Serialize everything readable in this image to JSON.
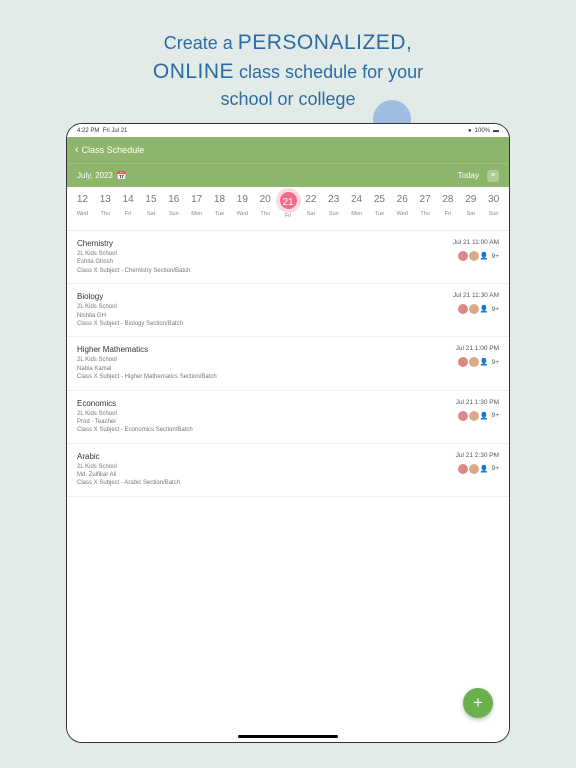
{
  "promo": {
    "line1_a": "Create a ",
    "line1_b": "PERSONALIZED,",
    "line2_a": "ONLINE",
    "line2_b": " class schedule for your",
    "line3": "school or college"
  },
  "status": {
    "time": "4:22 PM",
    "date": "Fri Jul 21",
    "battery": "100%"
  },
  "nav": {
    "back": "Class Schedule"
  },
  "toolbar": {
    "month": "July, 2023",
    "today": "Today"
  },
  "days": [
    {
      "n": "12",
      "d": "Wed"
    },
    {
      "n": "13",
      "d": "Thu"
    },
    {
      "n": "14",
      "d": "Fri"
    },
    {
      "n": "15",
      "d": "Sat"
    },
    {
      "n": "16",
      "d": "Sun"
    },
    {
      "n": "17",
      "d": "Mon"
    },
    {
      "n": "18",
      "d": "Tue"
    },
    {
      "n": "19",
      "d": "Wed"
    },
    {
      "n": "20",
      "d": "Thu"
    },
    {
      "n": "21",
      "d": "Fri",
      "sel": true
    },
    {
      "n": "22",
      "d": "Sat"
    },
    {
      "n": "23",
      "d": "Sun"
    },
    {
      "n": "24",
      "d": "Mon"
    },
    {
      "n": "25",
      "d": "Tue"
    },
    {
      "n": "26",
      "d": "Wed"
    },
    {
      "n": "27",
      "d": "Thu"
    },
    {
      "n": "28",
      "d": "Fri"
    },
    {
      "n": "29",
      "d": "Sat"
    },
    {
      "n": "30",
      "d": "Sun"
    }
  ],
  "classes": [
    {
      "title": "Chemistry",
      "school": "2L Kids School",
      "teacher": "Eshita Ghosh",
      "desc": "Class X  Subject - Chemistry  Section/Batch",
      "time": "Jul 21 11:00 AM",
      "plus": "9+"
    },
    {
      "title": "Biology",
      "school": "2L Kids School",
      "teacher": "Nishita GH",
      "desc": "Class X  Subject - Biology Section/Batch",
      "time": "Jul 21 11:30 AM",
      "plus": "9+"
    },
    {
      "title": "Higher Mathematics",
      "school": "2L Kids School",
      "teacher": "Nabia Kamal",
      "desc": "Class X  Subject - Higher Mathematics Section/Batch",
      "time": "Jul 21 1:00 PM",
      "plus": "9+"
    },
    {
      "title": "Economics",
      "school": "2L Kids School",
      "teacher": "Prod - Teacher",
      "desc": "Class X  Subject - Economics Section/Batch",
      "time": "Jul 21 1:30 PM",
      "plus": "9+"
    },
    {
      "title": "Arabic",
      "school": "2L Kids School",
      "teacher": "Md. Zulfikar Ali",
      "desc": "Class X  Subject - Arabic Section/Batch",
      "time": "Jul 21 2:30 PM",
      "plus": "9+"
    }
  ]
}
